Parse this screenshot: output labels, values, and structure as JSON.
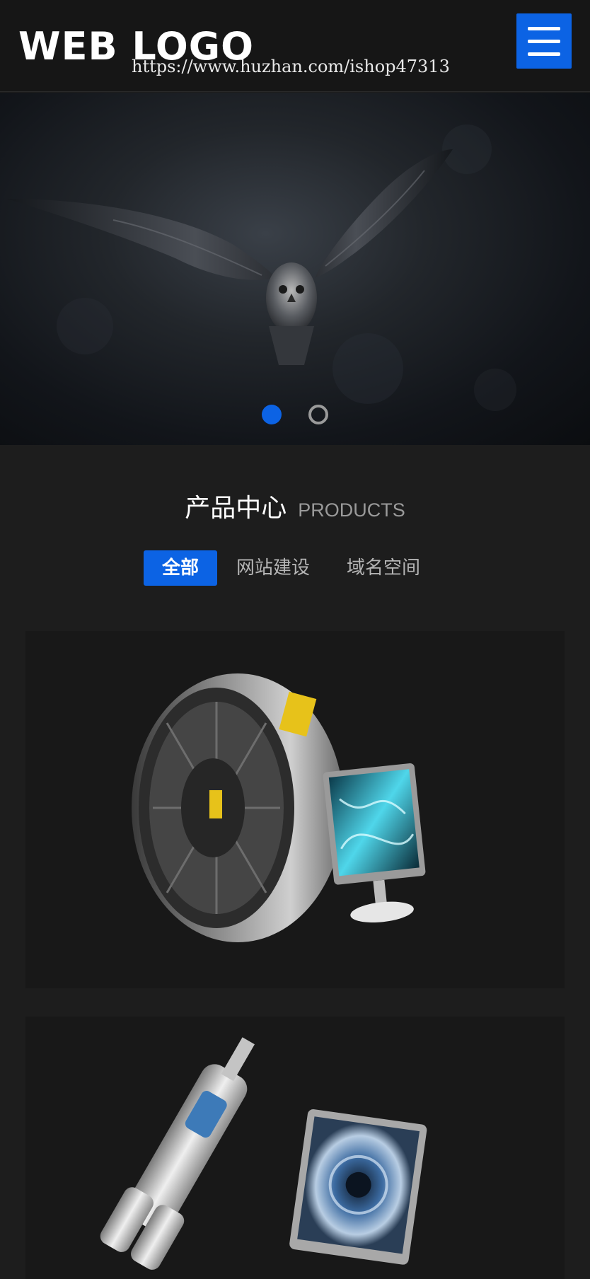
{
  "header": {
    "logo_text": "WEB LOGO",
    "watermark": "https://www.huzhan.com/ishop47313",
    "menu_icon": "hamburger-menu-icon",
    "accent_color": "#0c63e4"
  },
  "banner": {
    "image": "owl-in-flight",
    "slides_count": 2,
    "active_slide": 1
  },
  "products": {
    "title_cn": "产品中心",
    "title_en": "PRODUCTS",
    "tabs": [
      {
        "label": "全部",
        "active": true
      },
      {
        "label": "网站建设",
        "active": false
      },
      {
        "label": "域名空间",
        "active": false
      }
    ],
    "items": [
      {
        "image": "network-drive-with-monitor"
      },
      {
        "image": "telescope-with-monitor"
      }
    ]
  }
}
